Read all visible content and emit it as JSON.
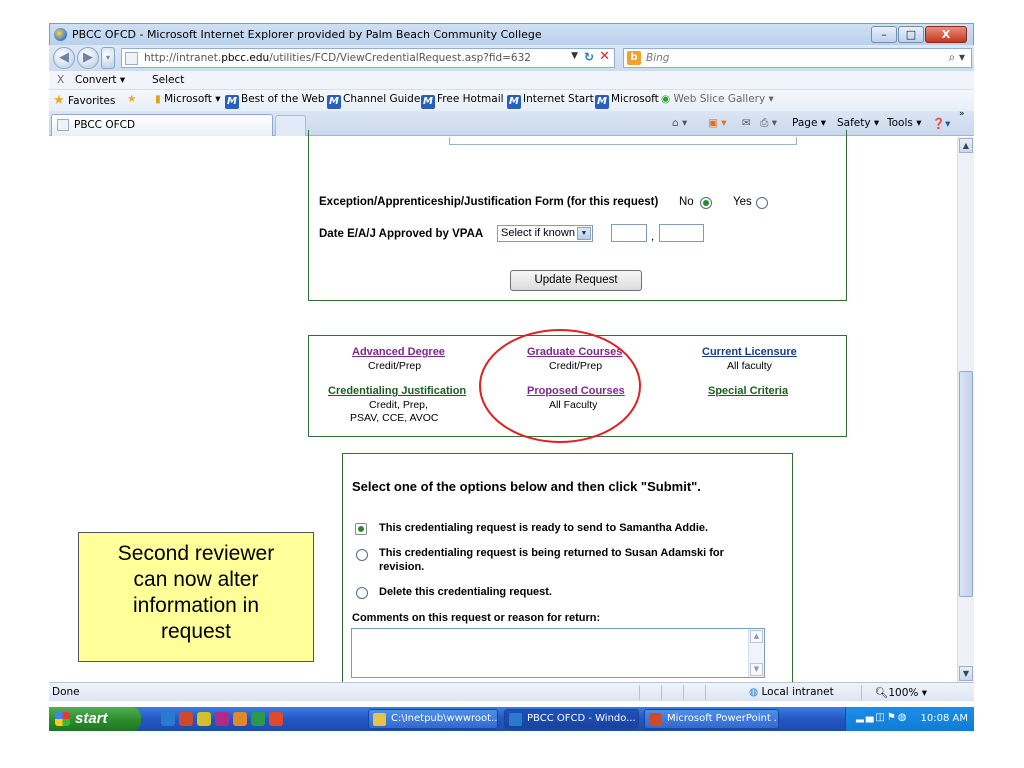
{
  "window": {
    "title": "PBCC OFCD - Microsoft Internet Explorer provided by Palm Beach Community College",
    "minimize": "–",
    "maximize": "□",
    "close": "X"
  },
  "address": {
    "url_prefix": "http://intranet.",
    "url_domain": "pbcc.edu",
    "url_rest": "/utilities/FCD/ViewCredentialRequest.asp?fid=632",
    "search_placeholder": "Bing"
  },
  "cmdbar": {
    "close": "X",
    "convert": "Convert ▾",
    "select": "Select"
  },
  "favorites": {
    "favorites_label": "Favorites",
    "items": [
      "Microsoft ▾",
      "Best of the Web",
      "Channel Guide",
      "Free Hotmail",
      "Internet Start",
      "Microsoft",
      "Web Slice Gallery ▾"
    ]
  },
  "tab": {
    "label": "PBCC OFCD"
  },
  "toolbar": {
    "page": "Page ▾",
    "safety": "Safety ▾",
    "tools": "Tools ▾",
    "more": "»"
  },
  "form": {
    "exception_label": "Exception/Apprenticeship/Justification Form (for this request)",
    "no_label": "No",
    "yes_label": "Yes",
    "exception_value": "No",
    "date_label": "Date E/A/J Approved by VPAA",
    "date_select": "Select if known",
    "comma": ",",
    "update_button": "Update Request"
  },
  "links": [
    {
      "title": "Advanced Degree",
      "sub": "Credit/Prep"
    },
    {
      "title": "Graduate Courses",
      "sub": "Credit/Prep"
    },
    {
      "title": "Current Licensure",
      "sub": "All faculty"
    },
    {
      "title": "Credentialing Justification",
      "sub": "Credit, Prep,",
      "sub2": "PSAV, CCE, AVOC"
    },
    {
      "title": "Proposed Courses",
      "sub": "All Faculty"
    },
    {
      "title": "Special Criteria",
      "sub": ""
    }
  ],
  "options": {
    "heading": "Select one of the options below and then click \"Submit\".",
    "items": [
      "This credentialing request is ready to send to Samantha Addie.",
      "This credentialing request is being returned to Susan Adamski for",
      "revision.",
      "Delete this credentialing request."
    ],
    "selected": 0,
    "comments_label": "Comments on this request or reason for return:"
  },
  "callout": {
    "lines": [
      "Second reviewer",
      "can now alter",
      "information in",
      "request"
    ]
  },
  "status": {
    "text": "Done",
    "zone": "Local intranet",
    "zoom": "100%"
  },
  "taskbar": {
    "start": "start",
    "tasks": [
      "C:\\Inetpub\\wwwroot...",
      "PBCC OFCD - Windo...",
      "Microsoft PowerPoint ..."
    ],
    "clock": "10:08 AM"
  },
  "colors": {
    "highlight_circle": "#e02020",
    "section_border": "#3a6b3a",
    "callout_bg": "#ffff99"
  }
}
